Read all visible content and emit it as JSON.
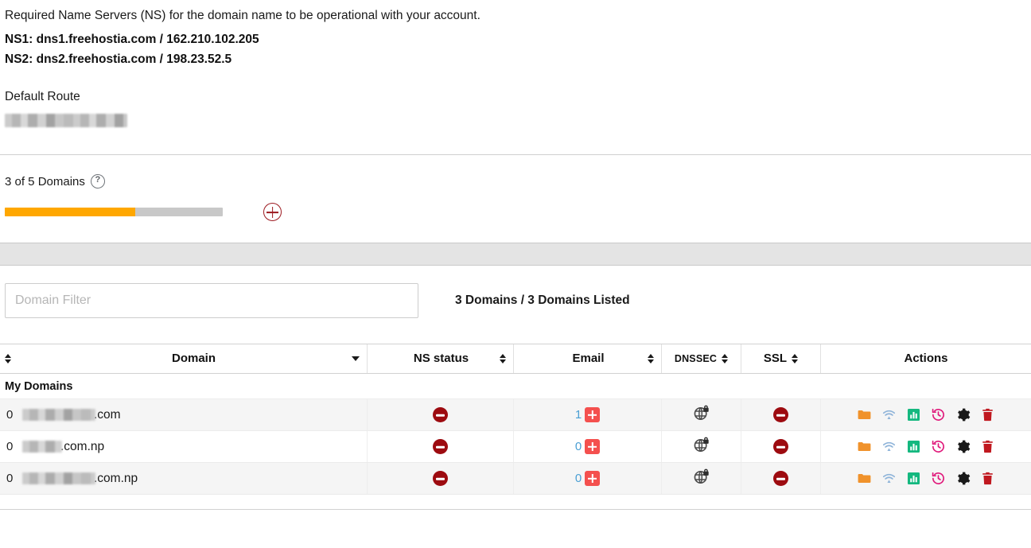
{
  "ns_info": {
    "intro": "Required Name Servers (NS) for the domain name to be operational with your account.",
    "ns1": "NS1: dns1.freehostia.com / 162.210.102.205",
    "ns2": "NS2: dns2.freehostia.com / 198.23.52.5"
  },
  "default_route": {
    "label": "Default Route",
    "value_redacted": true
  },
  "quota": {
    "label": "3 of 5 Domains",
    "help_icon": "question-mark-icon",
    "used": 3,
    "total": 5,
    "percent": 60,
    "bar_color": "#ffa700",
    "track_color": "#c8c8c8",
    "add_button_icon": "plus-circle-icon",
    "add_button_color": "#9d1a20"
  },
  "filter": {
    "placeholder": "Domain Filter",
    "value": "",
    "count_text": "3 Domains / 3 Domains Listed"
  },
  "table": {
    "columns": [
      {
        "key": "idx",
        "label": "",
        "sort": "both"
      },
      {
        "key": "domain",
        "label": "Domain",
        "sort": "caret"
      },
      {
        "key": "ns",
        "label": "NS status",
        "sort": "both"
      },
      {
        "key": "email",
        "label": "Email",
        "sort": "both"
      },
      {
        "key": "dnssec",
        "label": "DNSSEC",
        "sort": "both"
      },
      {
        "key": "ssl",
        "label": "SSL",
        "sort": "both"
      },
      {
        "key": "actions",
        "label": "Actions",
        "sort": "none"
      }
    ],
    "group_label": "My Domains",
    "rows": [
      {
        "index": "0",
        "domain_redacted": true,
        "domain_suffix": ".com",
        "redacted_width": 92,
        "ns_status": "denied",
        "email_count": "1",
        "email_add_icon": "plus-square-icon",
        "dnssec_icon": "globe-lock-icon",
        "ssl_status": "denied"
      },
      {
        "index": "0",
        "domain_redacted": true,
        "domain_suffix": ".com.np",
        "redacted_width": 50,
        "ns_status": "denied",
        "email_count": "0",
        "email_add_icon": "plus-square-icon",
        "dnssec_icon": "globe-lock-icon",
        "ssl_status": "denied"
      },
      {
        "index": "0",
        "domain_redacted": true,
        "domain_suffix": ".com.np",
        "redacted_width": 92,
        "ns_status": "denied",
        "email_count": "0",
        "email_add_icon": "plus-square-icon",
        "dnssec_icon": "globe-lock-icon",
        "ssl_status": "denied"
      }
    ],
    "action_icons": [
      {
        "name": "folder-icon",
        "color": "#f0922b"
      },
      {
        "name": "wifi-signal-icon",
        "color": "#8fb4d9"
      },
      {
        "name": "bar-chart-icon",
        "color": "#14b87f"
      },
      {
        "name": "history-clock-icon",
        "color": "#e0197b"
      },
      {
        "name": "gear-icon",
        "color": "#1a1a1a"
      },
      {
        "name": "trash-icon",
        "color": "#c0181f"
      }
    ]
  }
}
